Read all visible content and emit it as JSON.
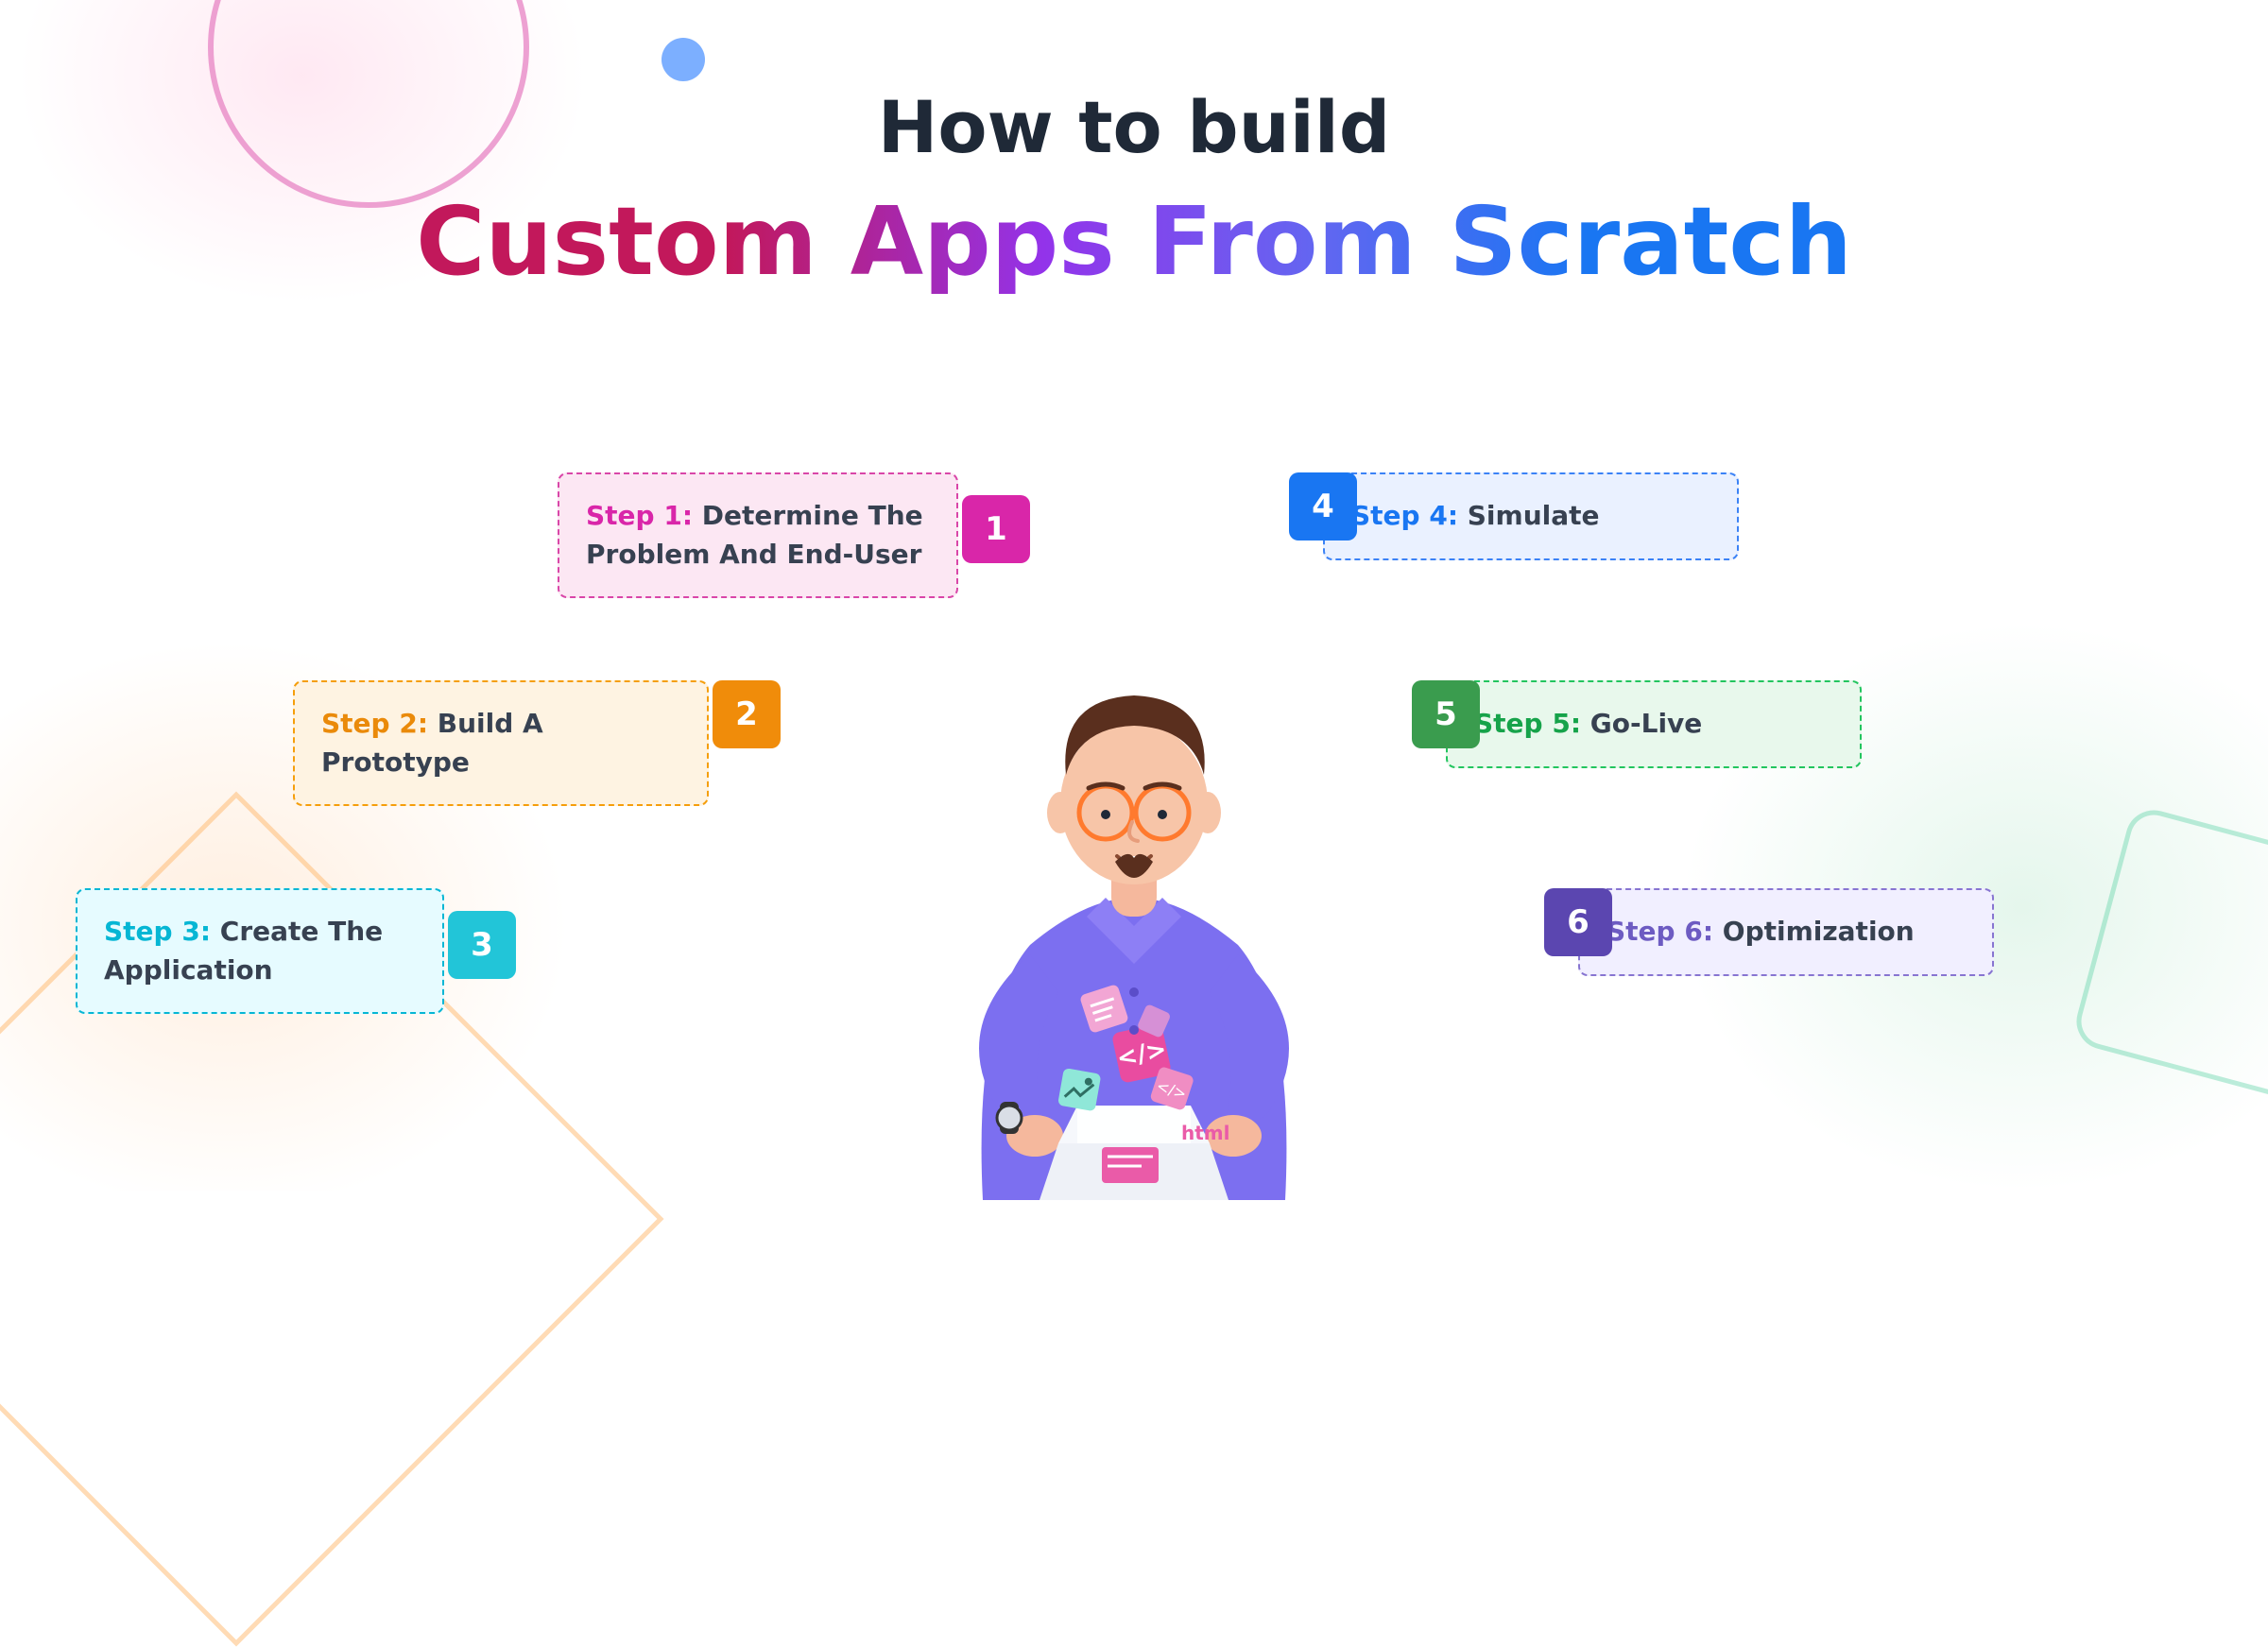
{
  "title_line1": "How to build",
  "title_line2": "Custom Apps From Scratch",
  "steps": [
    {
      "num": "1",
      "label": "Step 1:",
      "text": " Determine The Problem And End-User"
    },
    {
      "num": "2",
      "label": "Step 2:",
      "text": " Build A Prototype"
    },
    {
      "num": "3",
      "label": "Step 3:",
      "text": " Create The Application"
    },
    {
      "num": "4",
      "label": "Step 4:",
      "text": " Simulate"
    },
    {
      "num": "5",
      "label": "Step 5:",
      "text": " Go-Live"
    },
    {
      "num": "6",
      "label": "Step 6:",
      "text": " Optimization"
    }
  ],
  "box_label": "html"
}
